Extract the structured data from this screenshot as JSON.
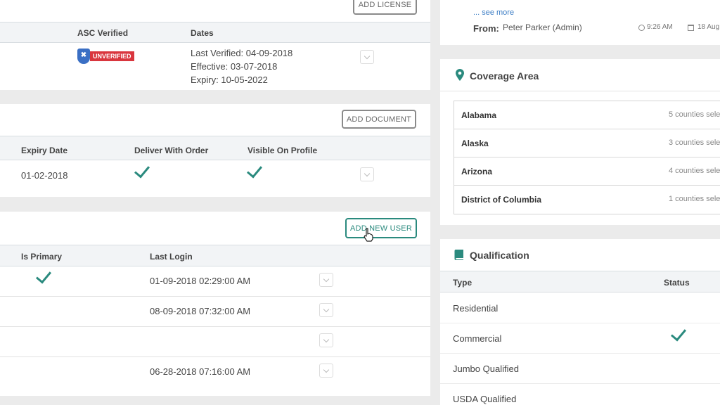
{
  "license": {
    "add_button": "ADD LICENSE",
    "columns": {
      "asc_verified": "ASC Verified",
      "dates": "Dates"
    },
    "badge": "UNVERIFIED",
    "last_verified": "Last Verified: 04-09-2018",
    "effective": "Effective: 03-07-2018",
    "expiry": "Expiry: 10-05-2022"
  },
  "documents": {
    "add_button": "ADD DOCUMENT",
    "columns": {
      "expiry": "Expiry Date",
      "deliver": "Deliver With Order",
      "visible": "Visible On Profile"
    },
    "row": {
      "expiry": "01-02-2018",
      "deliver_with_order": true,
      "visible_on_profile": true
    }
  },
  "users": {
    "add_button": "ADD NEW USER",
    "columns": {
      "primary": "Is Primary",
      "last_login": "Last Login"
    },
    "rows": [
      {
        "is_primary": true,
        "last_login": "01-09-2018 02:29:00 AM"
      },
      {
        "is_primary": false,
        "last_login": "08-09-2018 07:32:00 AM"
      },
      {
        "is_primary": false,
        "last_login": ""
      },
      {
        "is_primary": false,
        "last_login": "06-28-2018 07:16:00 AM"
      }
    ]
  },
  "message": {
    "see_more": "... see more",
    "from_label": "From:",
    "from_name": "Peter Parker (Admin)",
    "time": "9:26 AM",
    "date": "18 Aug"
  },
  "coverage": {
    "title": "Coverage Area",
    "rows": [
      {
        "state": "Alabama",
        "count": "5 counties sele"
      },
      {
        "state": "Alaska",
        "count": "3 counties sele"
      },
      {
        "state": "Arizona",
        "count": "4 counties sele"
      },
      {
        "state": "District of Columbia",
        "count": "1 counties sele"
      }
    ]
  },
  "qualification": {
    "title": "Qualification",
    "columns": {
      "type": "Type",
      "status": "Status"
    },
    "rows": [
      {
        "type": "Residential",
        "status": false
      },
      {
        "type": "Commercial",
        "status": true
      },
      {
        "type": "Jumbo Qualified",
        "status": false
      },
      {
        "type": "USDA Qualified",
        "status": false
      }
    ]
  },
  "colors": {
    "accent": "#2a8a7e",
    "danger": "#d9363e",
    "shield": "#3a6fc4"
  }
}
